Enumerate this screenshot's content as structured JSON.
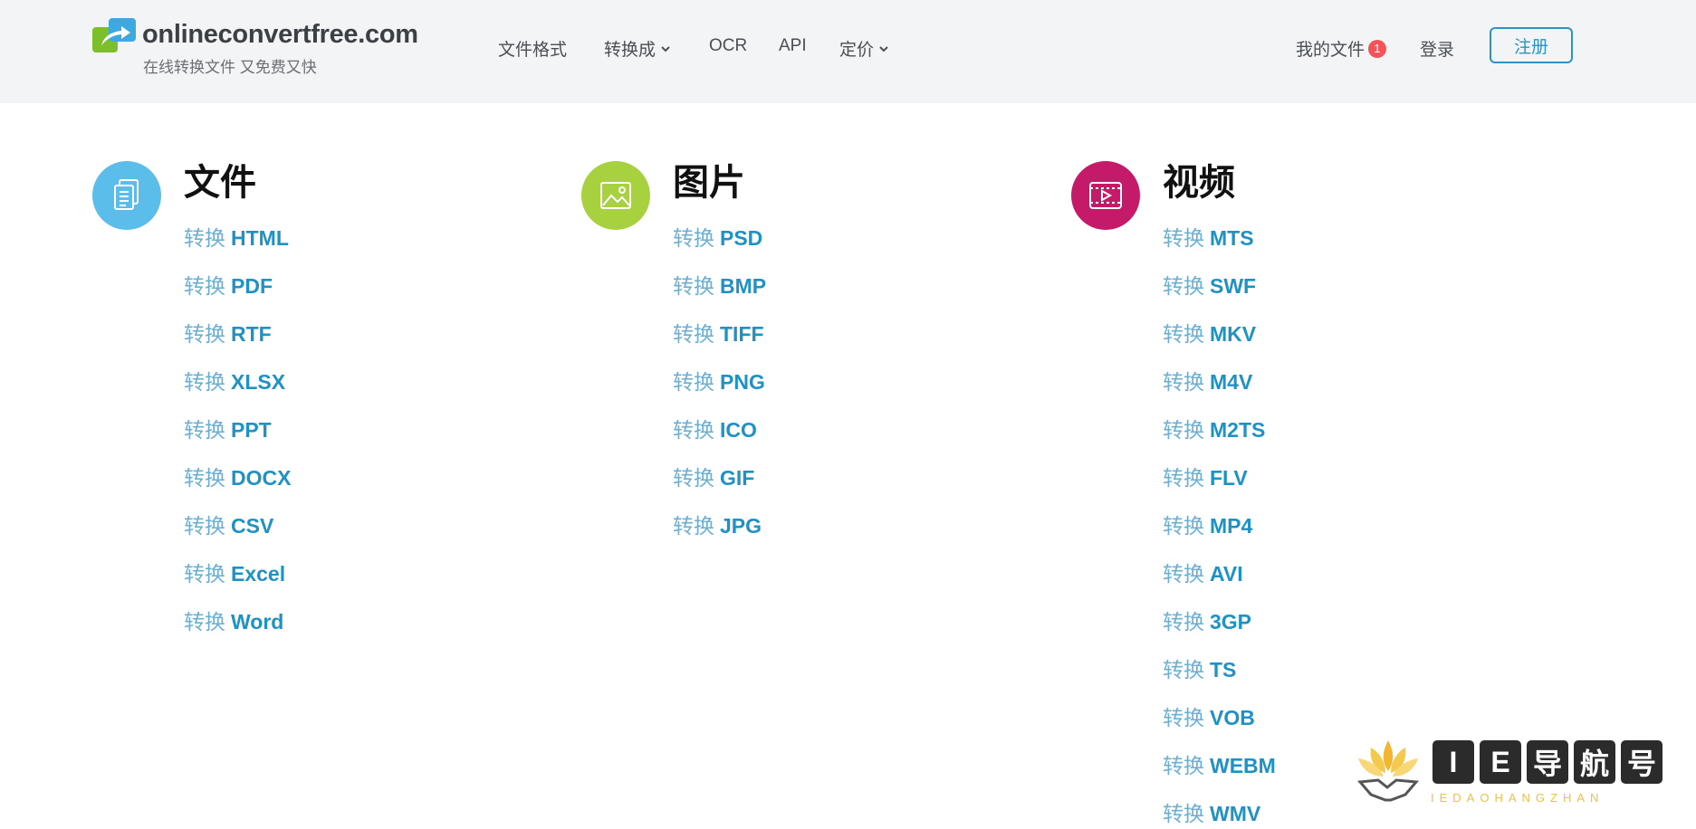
{
  "brand": {
    "name": "onlineconvertfree.com",
    "tagline": "在线转换文件 又免费又快"
  },
  "nav": {
    "formats": "文件格式",
    "convert_to": "转换成",
    "ocr": "OCR",
    "api": "API",
    "pricing": "定价"
  },
  "account": {
    "my_files": "我的文件",
    "my_files_count": "1",
    "login": "登录",
    "signup": "注册"
  },
  "colors": {
    "documents": "#5bbde9",
    "images": "#a8d13f",
    "videos": "#c51a6a",
    "link_format": "#1f92c4",
    "link_verb": "#6ab0d4"
  },
  "categories": [
    {
      "title": "文件",
      "icon": "document-icon",
      "items": [
        {
          "verb": "转换",
          "format": "HTML"
        },
        {
          "verb": "转换",
          "format": "PDF"
        },
        {
          "verb": "转换",
          "format": "RTF"
        },
        {
          "verb": "转换",
          "format": "XLSX"
        },
        {
          "verb": "转换",
          "format": "PPT"
        },
        {
          "verb": "转换",
          "format": "DOCX"
        },
        {
          "verb": "转换",
          "format": "CSV"
        },
        {
          "verb": "转换",
          "format": "Excel"
        },
        {
          "verb": "转换",
          "format": "Word"
        }
      ]
    },
    {
      "title": "图片",
      "icon": "image-icon",
      "items": [
        {
          "verb": "转换",
          "format": "PSD"
        },
        {
          "verb": "转换",
          "format": "BMP"
        },
        {
          "verb": "转换",
          "format": "TIFF"
        },
        {
          "verb": "转换",
          "format": "PNG"
        },
        {
          "verb": "转换",
          "format": "ICO"
        },
        {
          "verb": "转换",
          "format": "GIF"
        },
        {
          "verb": "转换",
          "format": "JPG"
        }
      ]
    },
    {
      "title": "视频",
      "icon": "video-icon",
      "items": [
        {
          "verb": "转换",
          "format": "MTS"
        },
        {
          "verb": "转换",
          "format": "SWF"
        },
        {
          "verb": "转换",
          "format": "MKV"
        },
        {
          "verb": "转换",
          "format": "M4V"
        },
        {
          "verb": "转换",
          "format": "M2TS"
        },
        {
          "verb": "转换",
          "format": "FLV"
        },
        {
          "verb": "转换",
          "format": "MP4"
        },
        {
          "verb": "转换",
          "format": "AVI"
        },
        {
          "verb": "转换",
          "format": "3GP"
        },
        {
          "verb": "转换",
          "format": "TS"
        },
        {
          "verb": "转换",
          "format": "VOB"
        },
        {
          "verb": "转换",
          "format": "WEBM"
        },
        {
          "verb": "转换",
          "format": "WMV"
        }
      ]
    }
  ],
  "watermark": {
    "chars": [
      "I",
      "E",
      "导",
      "航",
      "号"
    ],
    "subtitle": "IEDAOHANGZHAN"
  }
}
